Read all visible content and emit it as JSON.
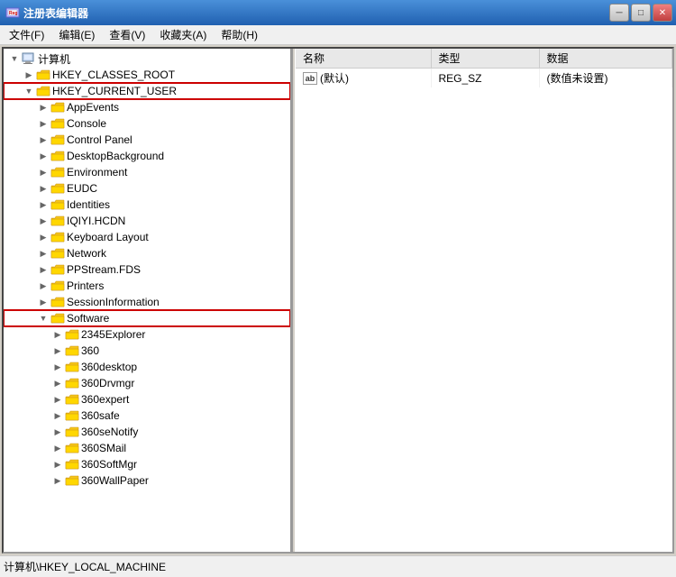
{
  "window": {
    "title": "注册表编辑器",
    "icon": "regedit-icon"
  },
  "titlebar": {
    "minimize_label": "─",
    "maximize_label": "□",
    "close_label": "✕"
  },
  "menubar": {
    "items": [
      {
        "label": "文件(F)"
      },
      {
        "label": "编辑(E)"
      },
      {
        "label": "查看(V)"
      },
      {
        "label": "收藏夹(A)"
      },
      {
        "label": "帮助(H)"
      }
    ]
  },
  "tree": {
    "root": {
      "label": "计算机",
      "expanded": true
    },
    "items": [
      {
        "id": "hkcr",
        "label": "HKEY_CLASSES_ROOT",
        "indent": 2,
        "expanded": false,
        "highlighted": false
      },
      {
        "id": "hkcu",
        "label": "HKEY_CURRENT_USER",
        "indent": 2,
        "expanded": true,
        "highlighted": true,
        "border": true
      },
      {
        "id": "appevents",
        "label": "AppEvents",
        "indent": 3,
        "expanded": false
      },
      {
        "id": "console",
        "label": "Console",
        "indent": 3,
        "expanded": false
      },
      {
        "id": "controlpanel",
        "label": "Control Panel",
        "indent": 3,
        "expanded": false
      },
      {
        "id": "desktopbackground",
        "label": "DesktopBackground",
        "indent": 3,
        "expanded": false
      },
      {
        "id": "environment",
        "label": "Environment",
        "indent": 3,
        "expanded": false
      },
      {
        "id": "eudc",
        "label": "EUDC",
        "indent": 3,
        "expanded": false
      },
      {
        "id": "identities",
        "label": "Identities",
        "indent": 3,
        "expanded": false
      },
      {
        "id": "iqiyi",
        "label": "IQIYI.HCDN",
        "indent": 3,
        "expanded": false
      },
      {
        "id": "keyboard",
        "label": "Keyboard Layout",
        "indent": 3,
        "expanded": false
      },
      {
        "id": "network",
        "label": "Network",
        "indent": 3,
        "expanded": false
      },
      {
        "id": "ppstream",
        "label": "PPStream.FDS",
        "indent": 3,
        "expanded": false
      },
      {
        "id": "printers",
        "label": "Printers",
        "indent": 3,
        "expanded": false
      },
      {
        "id": "sessioninfo",
        "label": "SessionInformation",
        "indent": 3,
        "expanded": false
      },
      {
        "id": "software",
        "label": "Software",
        "indent": 3,
        "expanded": true,
        "highlighted": false,
        "border": true
      },
      {
        "id": "2345explorer",
        "label": "2345Explorer",
        "indent": 4,
        "expanded": false
      },
      {
        "id": "360",
        "label": "360",
        "indent": 4,
        "expanded": false
      },
      {
        "id": "360desktop",
        "label": "360desktop",
        "indent": 4,
        "expanded": false
      },
      {
        "id": "360drvmgr",
        "label": "360Drvmgr",
        "indent": 4,
        "expanded": false
      },
      {
        "id": "360expert",
        "label": "360expert",
        "indent": 4,
        "expanded": false
      },
      {
        "id": "360safe",
        "label": "360safe",
        "indent": 4,
        "expanded": false
      },
      {
        "id": "360senotify",
        "label": "360seNotify",
        "indent": 4,
        "expanded": false
      },
      {
        "id": "360smail",
        "label": "360SMail",
        "indent": 4,
        "expanded": false
      },
      {
        "id": "360softmgr",
        "label": "360SoftMgr",
        "indent": 4,
        "expanded": false
      },
      {
        "id": "360wallpaper",
        "label": "360WallPaper",
        "indent": 4,
        "expanded": false
      }
    ]
  },
  "right_pane": {
    "columns": [
      "名称",
      "类型",
      "数据"
    ],
    "rows": [
      {
        "name": "(默认)",
        "type": "REG_SZ",
        "data": "(数值未设置)",
        "icon": "ab-icon"
      }
    ]
  },
  "statusbar": {
    "text": "计算机\\HKEY_LOCAL_MACHINE"
  },
  "colors": {
    "selected_bg": "#3399ff",
    "border_highlight": "#cc0000",
    "header_bg": "#e8e8e8"
  }
}
